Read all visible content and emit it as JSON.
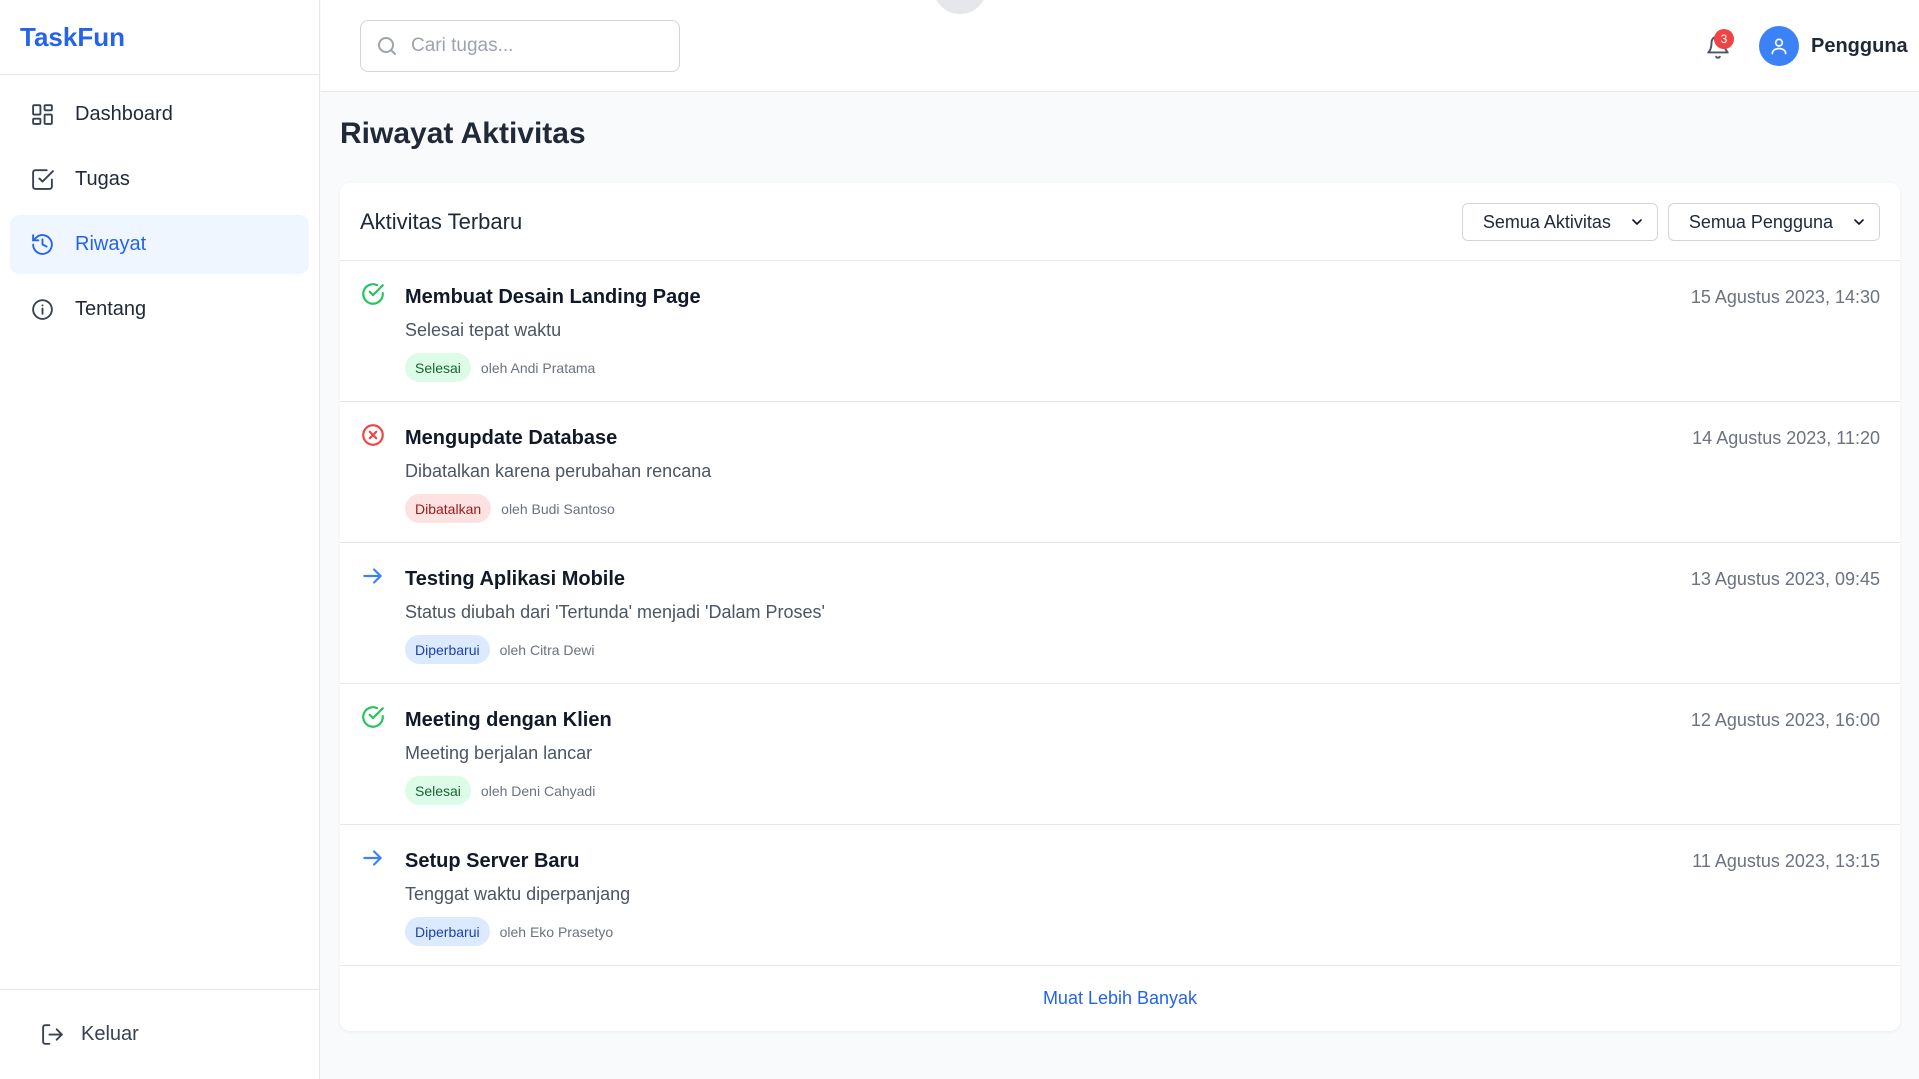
{
  "app": {
    "name": "TaskFun"
  },
  "sidebar": {
    "items": [
      {
        "label": "Dashboard",
        "icon": "dashboard-icon",
        "active": false
      },
      {
        "label": "Tugas",
        "icon": "checkbox-icon",
        "active": false
      },
      {
        "label": "Riwayat",
        "icon": "history-icon",
        "active": true
      },
      {
        "label": "Tentang",
        "icon": "info-icon",
        "active": false
      }
    ],
    "logout_label": "Keluar"
  },
  "header": {
    "search_placeholder": "Cari tugas...",
    "notification_count": "3",
    "user_name": "Pengguna"
  },
  "page": {
    "title": "Riwayat Aktivitas"
  },
  "card": {
    "title": "Aktivitas Terbaru",
    "filter_activity": "Semua Aktivitas",
    "filter_user": "Semua Pengguna",
    "load_more": "Muat Lebih Banyak"
  },
  "activities": [
    {
      "title": "Membuat Desain Landing Page",
      "desc": "Selesai tepat waktu",
      "status": "Selesai",
      "status_type": "done",
      "by": "oleh Andi Pratama",
      "time": "15 Agustus 2023, 14:30"
    },
    {
      "title": "Mengupdate Database",
      "desc": "Dibatalkan karena perubahan rencana",
      "status": "Dibatalkan",
      "status_type": "cancel",
      "by": "oleh Budi Santoso",
      "time": "14 Agustus 2023, 11:20"
    },
    {
      "title": "Testing Aplikasi Mobile",
      "desc": "Status diubah dari 'Tertunda' menjadi 'Dalam Proses'",
      "status": "Diperbarui",
      "status_type": "update",
      "by": "oleh Citra Dewi",
      "time": "13 Agustus 2023, 09:45"
    },
    {
      "title": "Meeting dengan Klien",
      "desc": "Meeting berjalan lancar",
      "status": "Selesai",
      "status_type": "done",
      "by": "oleh Deni Cahyadi",
      "time": "12 Agustus 2023, 16:00"
    },
    {
      "title": "Setup Server Baru",
      "desc": "Tenggat waktu diperpanjang",
      "status": "Diperbarui",
      "status_type": "update",
      "by": "oleh Eko Prasetyo",
      "time": "11 Agustus 2023, 13:15"
    }
  ],
  "colors": {
    "accent": "#2563eb",
    "done": "#22c55e",
    "cancel": "#ef4444",
    "update": "#3b82f6"
  }
}
